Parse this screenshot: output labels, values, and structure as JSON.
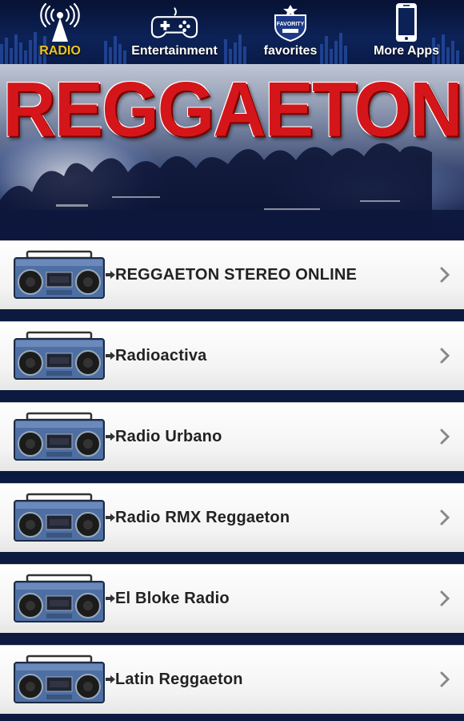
{
  "nav": {
    "tabs": [
      {
        "label": "RADIO",
        "icon": "radio-tower-icon",
        "active": true
      },
      {
        "label": "Entertainment",
        "icon": "gamepad-icon",
        "active": false
      },
      {
        "label": "favorites",
        "icon": "favorite-badge-icon",
        "active": false
      },
      {
        "label": "More Apps",
        "icon": "smartphone-icon",
        "active": false
      }
    ],
    "badge_text": "FAVORITY"
  },
  "banner": {
    "title": "REGGAETON"
  },
  "stations": [
    {
      "name": "REGGAETON STEREO ONLINE"
    },
    {
      "name": "Radioactiva"
    },
    {
      "name": "Radio Urbano"
    },
    {
      "name": "Radio RMX Reggaeton"
    },
    {
      "name": "El Bloke Radio"
    },
    {
      "name": "Latin Reggaeton"
    }
  ],
  "colors": {
    "active_tab": "#f0c419",
    "title_red": "#d4161a",
    "nav_bg": "#0c2257"
  }
}
